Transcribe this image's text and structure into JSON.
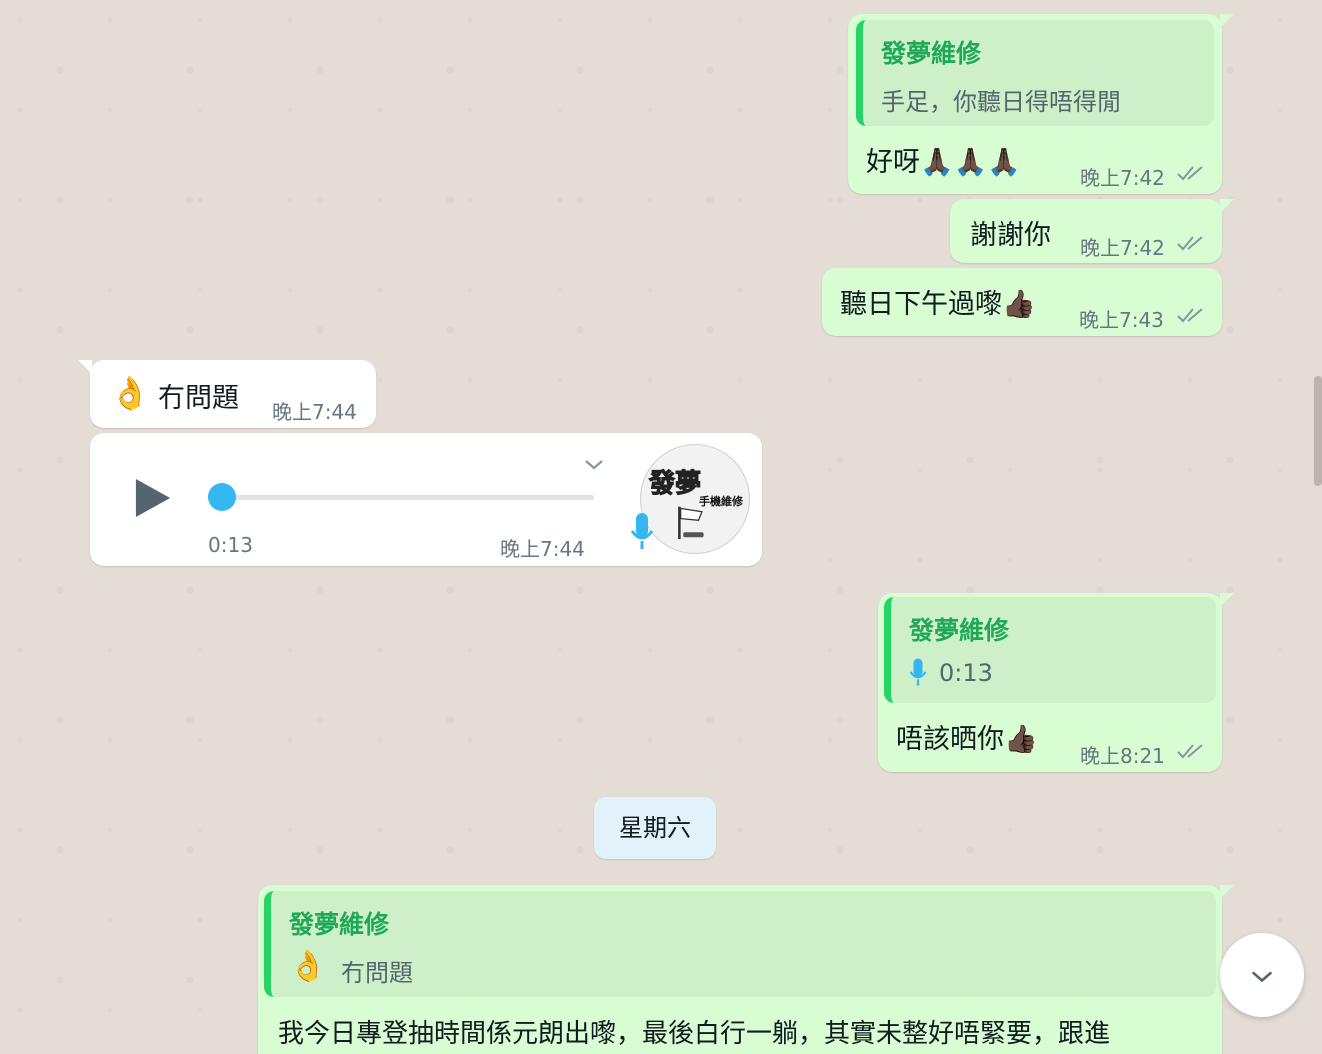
{
  "messages": {
    "m1": {
      "quote_name": "發夢維修",
      "quote_text": "手足，你聽日得唔得閒",
      "text": "好呀🙏🏿🙏🏿🙏🏿",
      "time": "晚上7:42"
    },
    "m2": {
      "text": "謝謝你",
      "time": "晚上7:42"
    },
    "m3": {
      "text": "聽日下午過嚟👍🏿",
      "time": "晚上7:43"
    },
    "m4": {
      "text": "冇問題",
      "emoji": "👌",
      "time": "晚上7:44"
    },
    "m5": {
      "duration": "0:13",
      "time": "晚上7:44",
      "progress": 0,
      "avatar_title": "發夢",
      "avatar_subtitle": "手機維修"
    },
    "m6": {
      "quote_name": "發夢維修",
      "quote_text": "0:13",
      "text": "唔該晒你👍🏿",
      "time": "晚上8:21"
    },
    "m7": {
      "quote_name": "發夢維修",
      "quote_emoji": "👌",
      "quote_text": "冇問題",
      "text": "我今日專登抽時間係元朗出嚟，最後白行一躺，其實未整好唔緊要，跟進"
    }
  },
  "date_separator": "星期六",
  "colors": {
    "outgoing_bubble": "#d9fdd3",
    "incoming_bubble": "#ffffff",
    "quote_accent": "#25d366",
    "quote_name": "#1fa855",
    "voice_accent": "#34b7f1",
    "read_ticks": "#8696a0"
  },
  "icons": {
    "read_status": "double-check-icon",
    "play": "play-icon",
    "mic": "mic-icon",
    "menu": "chevron-down-icon",
    "scroll_down": "chevron-down-icon"
  }
}
